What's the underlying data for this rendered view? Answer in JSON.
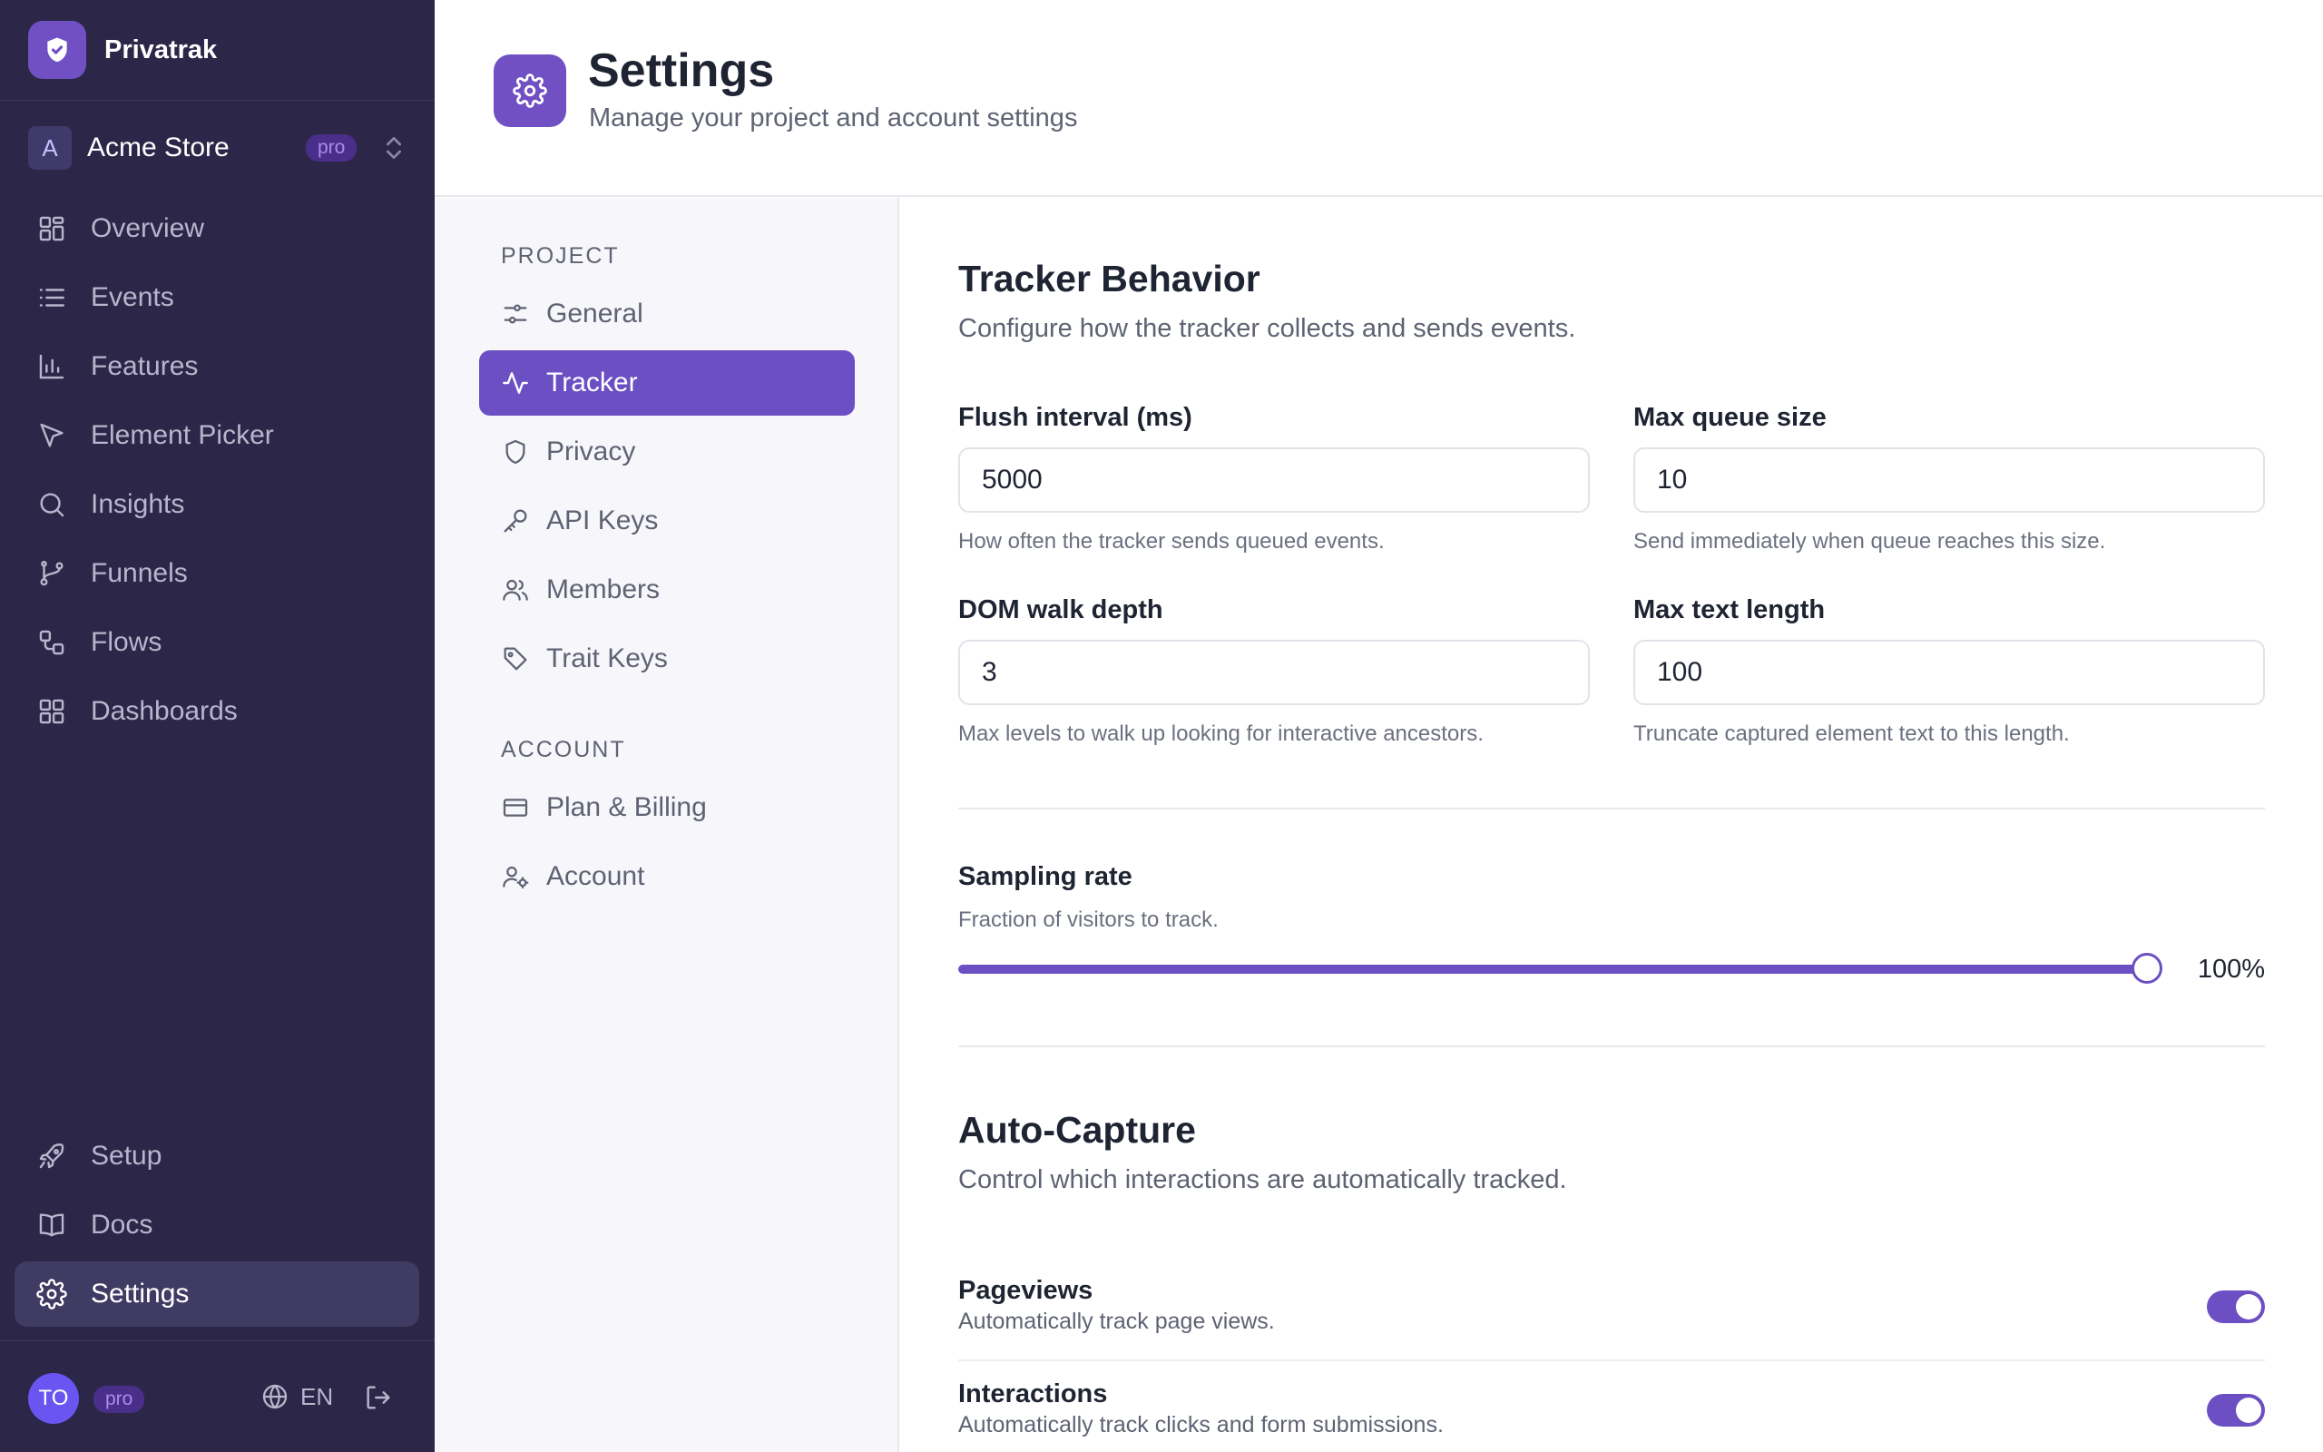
{
  "brand": {
    "name": "Privatrak",
    "icon": "shield-check-icon"
  },
  "project": {
    "avatar": "A",
    "name": "Acme Store",
    "badge": "pro"
  },
  "nav": {
    "main": [
      {
        "label": "Overview",
        "icon": "grid-icon"
      },
      {
        "label": "Events",
        "icon": "list-icon"
      },
      {
        "label": "Features",
        "icon": "bar-chart-icon"
      },
      {
        "label": "Element Picker",
        "icon": "cursor-icon"
      },
      {
        "label": "Insights",
        "icon": "search-icon"
      },
      {
        "label": "Funnels",
        "icon": "git-branch-icon"
      },
      {
        "label": "Flows",
        "icon": "flow-icon"
      },
      {
        "label": "Dashboards",
        "icon": "dashboard-icon"
      }
    ],
    "bottom": [
      {
        "label": "Setup",
        "icon": "rocket-icon"
      },
      {
        "label": "Docs",
        "icon": "book-icon"
      },
      {
        "label": "Settings",
        "icon": "gear-icon",
        "active": true
      }
    ]
  },
  "user": {
    "initials": "TO",
    "badge": "pro",
    "language": "EN"
  },
  "header": {
    "title": "Settings",
    "subtitle": "Manage your project and account settings"
  },
  "settings_menu": {
    "project_heading": "PROJECT",
    "project_items": [
      {
        "label": "General",
        "icon": "sliders-icon"
      },
      {
        "label": "Tracker",
        "icon": "activity-icon",
        "active": true
      },
      {
        "label": "Privacy",
        "icon": "shield-icon"
      },
      {
        "label": "API Keys",
        "icon": "key-icon"
      },
      {
        "label": "Members",
        "icon": "users-icon"
      },
      {
        "label": "Trait Keys",
        "icon": "tag-icon"
      }
    ],
    "account_heading": "ACCOUNT",
    "account_items": [
      {
        "label": "Plan & Billing",
        "icon": "credit-card-icon"
      },
      {
        "label": "Account",
        "icon": "user-cog-icon"
      }
    ]
  },
  "tracker": {
    "title": "Tracker Behavior",
    "description": "Configure how the tracker collects and sends events.",
    "flush_interval": {
      "label": "Flush interval (ms)",
      "value": "5000",
      "help": "How often the tracker sends queued events."
    },
    "max_queue": {
      "label": "Max queue size",
      "value": "10",
      "help": "Send immediately when queue reaches this size."
    },
    "dom_depth": {
      "label": "DOM walk depth",
      "value": "3",
      "help": "Max levels to walk up looking for interactive ancestors."
    },
    "max_text": {
      "label": "Max text length",
      "value": "100",
      "help": "Truncate captured element text to this length."
    },
    "sampling": {
      "label": "Sampling rate",
      "help": "Fraction of visitors to track.",
      "value": 1.0,
      "value_label": "100%"
    }
  },
  "autocapture": {
    "title": "Auto-Capture",
    "description": "Control which interactions are automatically tracked.",
    "pageviews": {
      "label": "Pageviews",
      "help": "Automatically track page views.",
      "enabled": true
    },
    "interactions": {
      "label": "Interactions",
      "help": "Automatically track clicks and form submissions.",
      "enabled": true
    }
  },
  "colors": {
    "sidebar_bg": "#2c2748",
    "accent": "#6b4fc3",
    "active_nav": "#403b63"
  }
}
